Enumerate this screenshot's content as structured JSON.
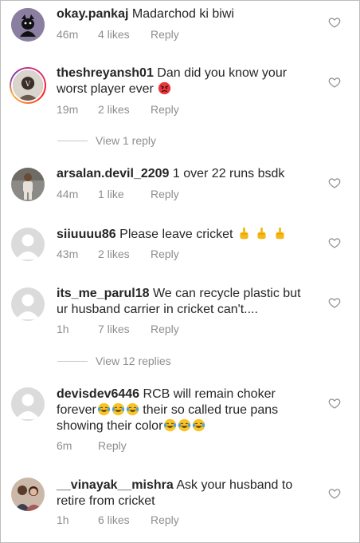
{
  "comments": [
    {
      "user": "okay.pankaj",
      "text": "Madarchod ki biwi",
      "time": "46m",
      "likes": "4 likes",
      "reply": "Reply",
      "emoji": ""
    },
    {
      "user": "theshreyansh01",
      "text": "Dan did you know your worst player ever",
      "time": "19m",
      "likes": "2 likes",
      "reply": "Reply",
      "emoji": "angry-face"
    },
    {
      "user": "arsalan.devil_2209",
      "text": "1 over 22 runs bsdk",
      "time": "44m",
      "likes": "1 like",
      "reply": "Reply",
      "emoji": ""
    },
    {
      "user": "siiuuuu86",
      "text": "Please leave cricket",
      "time": "43m",
      "likes": "2 likes",
      "reply": "Reply",
      "emoji": "middle-finger x3"
    },
    {
      "user": "its_me_parul18",
      "text": "We can recycle plastic but ur husband carrier in cricket can't....",
      "time": "1h",
      "likes": "7 likes",
      "reply": "Reply",
      "emoji": ""
    },
    {
      "user": "devisdev6446",
      "text_a": "RCB will remain choker forever",
      "text_b": "their so called true pans showing their color",
      "time": "6m",
      "likes": "",
      "reply": "Reply",
      "emoji": "laughing-tears x3"
    },
    {
      "user": "__vinayak__mishra",
      "text": "Ask your husband to retire from cricket",
      "time": "1h",
      "likes": "6 likes",
      "reply": "Reply",
      "emoji": ""
    }
  ],
  "view_replies": {
    "first": "View 1 reply",
    "second": "View 12 replies"
  },
  "colors": {
    "text": "#262626",
    "meta": "#8e8e8e",
    "border": "#bdbdbd"
  }
}
